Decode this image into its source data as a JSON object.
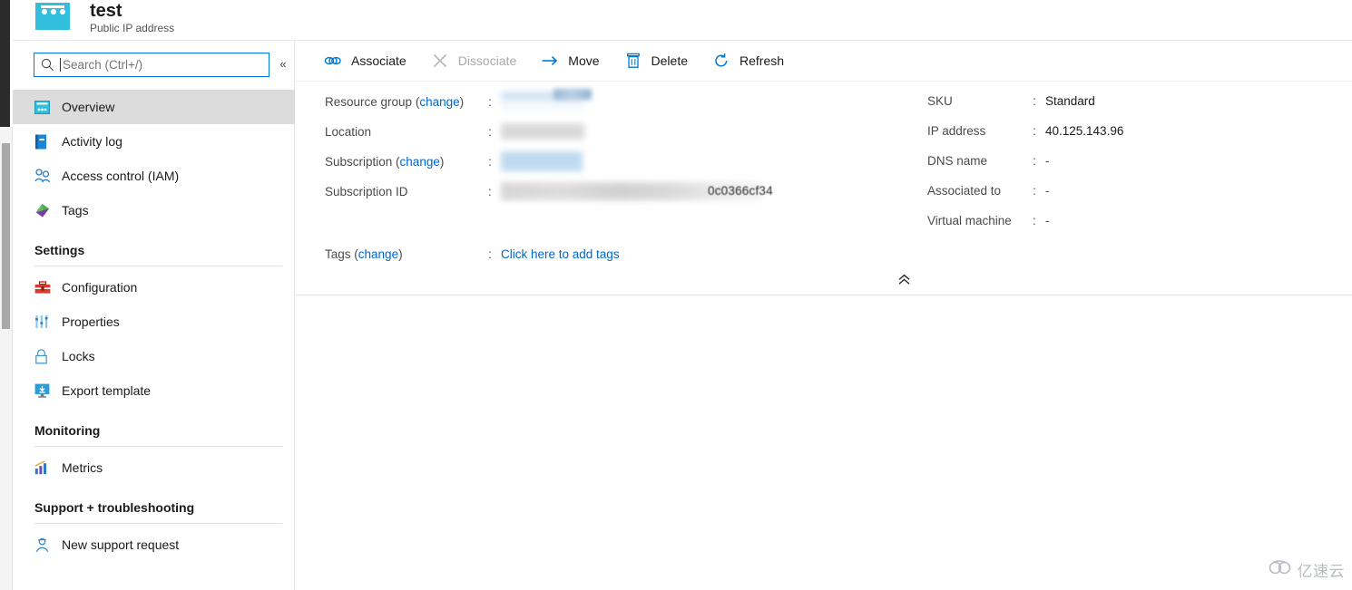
{
  "header": {
    "icon": "public-ip-address-icon",
    "title": "test",
    "subtitle": "Public IP address"
  },
  "sidebar": {
    "search": {
      "placeholder": "Search (Ctrl+/)",
      "value": "",
      "icon": "search-icon"
    },
    "collapse_label": "«",
    "items": [
      {
        "label": "Overview",
        "icon": "overview-icon",
        "selected": true
      },
      {
        "label": "Activity log",
        "icon": "activity-log-icon",
        "selected": false
      },
      {
        "label": "Access control (IAM)",
        "icon": "access-control-icon",
        "selected": false
      },
      {
        "label": "Tags",
        "icon": "tags-icon",
        "selected": false
      }
    ],
    "sections": [
      {
        "title": "Settings",
        "items": [
          {
            "label": "Configuration",
            "icon": "configuration-icon"
          },
          {
            "label": "Properties",
            "icon": "properties-icon"
          },
          {
            "label": "Locks",
            "icon": "lock-icon"
          },
          {
            "label": "Export template",
            "icon": "export-template-icon"
          }
        ]
      },
      {
        "title": "Monitoring",
        "items": [
          {
            "label": "Metrics",
            "icon": "metrics-icon"
          }
        ]
      },
      {
        "title": "Support + troubleshooting",
        "items": [
          {
            "label": "New support request",
            "icon": "support-request-icon"
          }
        ]
      }
    ]
  },
  "toolbar": {
    "buttons": [
      {
        "label": "Associate",
        "icon": "link-icon",
        "disabled": false
      },
      {
        "label": "Dissociate",
        "icon": "x-icon",
        "disabled": true
      },
      {
        "label": "Move",
        "icon": "arrow-right-icon",
        "disabled": false
      },
      {
        "label": "Delete",
        "icon": "trash-icon",
        "disabled": false
      },
      {
        "label": "Refresh",
        "icon": "refresh-icon",
        "disabled": false
      }
    ]
  },
  "essentials": {
    "left": [
      {
        "label": "Resource group",
        "change_link": "change",
        "colon": ":",
        "value": "",
        "redacted": true
      },
      {
        "label": "Location",
        "change_link": "",
        "colon": ":",
        "value": "",
        "redacted": true
      },
      {
        "label": "Subscription",
        "change_link": "change",
        "colon": ":",
        "value": "",
        "redacted": true
      },
      {
        "label": "Subscription ID",
        "change_link": "",
        "colon": ":",
        "value": "",
        "redacted": true,
        "visible_tail": "0c0366cf34"
      }
    ],
    "right": [
      {
        "label": "SKU",
        "colon": ":",
        "value": "Standard"
      },
      {
        "label": "IP address",
        "colon": ":",
        "value": "40.125.143.96"
      },
      {
        "label": "DNS name",
        "colon": ":",
        "value": "-"
      },
      {
        "label": "Associated to",
        "colon": ":",
        "value": "-"
      },
      {
        "label": "Virtual machine",
        "colon": ":",
        "value": "-"
      }
    ],
    "tags": {
      "label": "Tags",
      "change_link": "change",
      "colon": ":",
      "link_text": "Click here to add tags"
    },
    "collapse_label": "«"
  },
  "watermark": {
    "text": "亿速云",
    "icon": "cloud-icon"
  },
  "colors": {
    "accent": "#0078d4",
    "link": "#0066cc",
    "selected_nav": "#dcdcdc",
    "icon_cyan": "#32bedd",
    "disabled_text": "#a9a9a9"
  }
}
